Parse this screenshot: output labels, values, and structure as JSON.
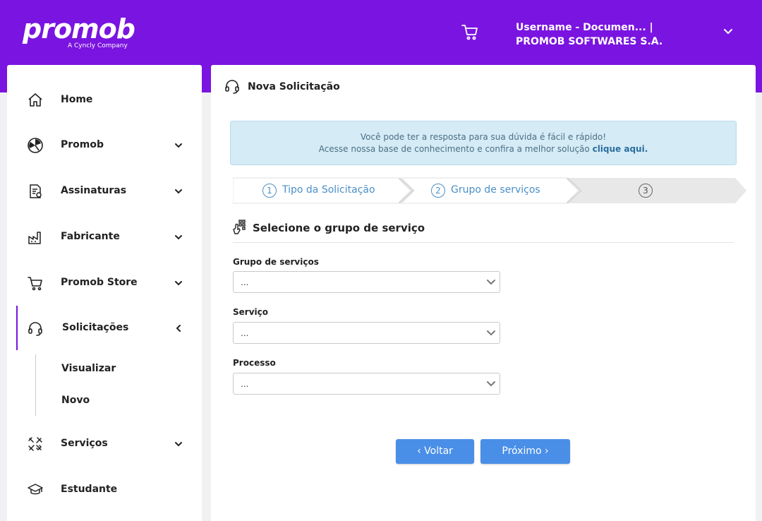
{
  "header": {
    "logo_word": "promob",
    "logo_sub": "A Cyncly Company",
    "user_line": "Username - Documen... | PROMOB SOFTWARES S.A.",
    "cart_icon": "cart-icon",
    "chevron_icon": "chevron-down-icon"
  },
  "sidebar": {
    "items": [
      {
        "label": "Home",
        "icon": "home-icon"
      },
      {
        "label": "Promob",
        "icon": "promob-icon"
      },
      {
        "label": "Assinaturas",
        "icon": "document-icon"
      },
      {
        "label": "Fabricante",
        "icon": "factory-icon"
      },
      {
        "label": "Promob Store",
        "icon": "cart-icon"
      },
      {
        "label": "Solicitações",
        "icon": "headset-icon"
      },
      {
        "label": "Serviços",
        "icon": "tools-icon"
      },
      {
        "label": "Estudante",
        "icon": "graduation-cap-icon"
      }
    ],
    "submenu": [
      {
        "label": "Visualizar"
      },
      {
        "label": "Novo"
      }
    ]
  },
  "main": {
    "title": "Nova Solicitação",
    "info_line1": "Você pode ter a resposta para sua dúvida é fácil e rápido!",
    "info_line2": "Acesse nossa base de conhecimento e confira a melhor solução",
    "info_link": "clique aqui.",
    "steps": [
      {
        "num": "1",
        "label": "Tipo da Solicitação"
      },
      {
        "num": "2",
        "label": "Grupo de serviços"
      },
      {
        "num": "3",
        "label": ""
      }
    ],
    "section_title": "Selecione o grupo de serviço",
    "fields": [
      {
        "label": "Grupo de serviços",
        "value": "..."
      },
      {
        "label": "Serviço",
        "value": "..."
      },
      {
        "label": "Processo",
        "value": "..."
      }
    ],
    "back_label": "Voltar",
    "next_label": "Próximo"
  },
  "colors": {
    "brand": "#7a14e0",
    "primary_button": "#4a8fe7",
    "info_bg": "#d5ebf5",
    "step_active": "#4a8fc7"
  }
}
